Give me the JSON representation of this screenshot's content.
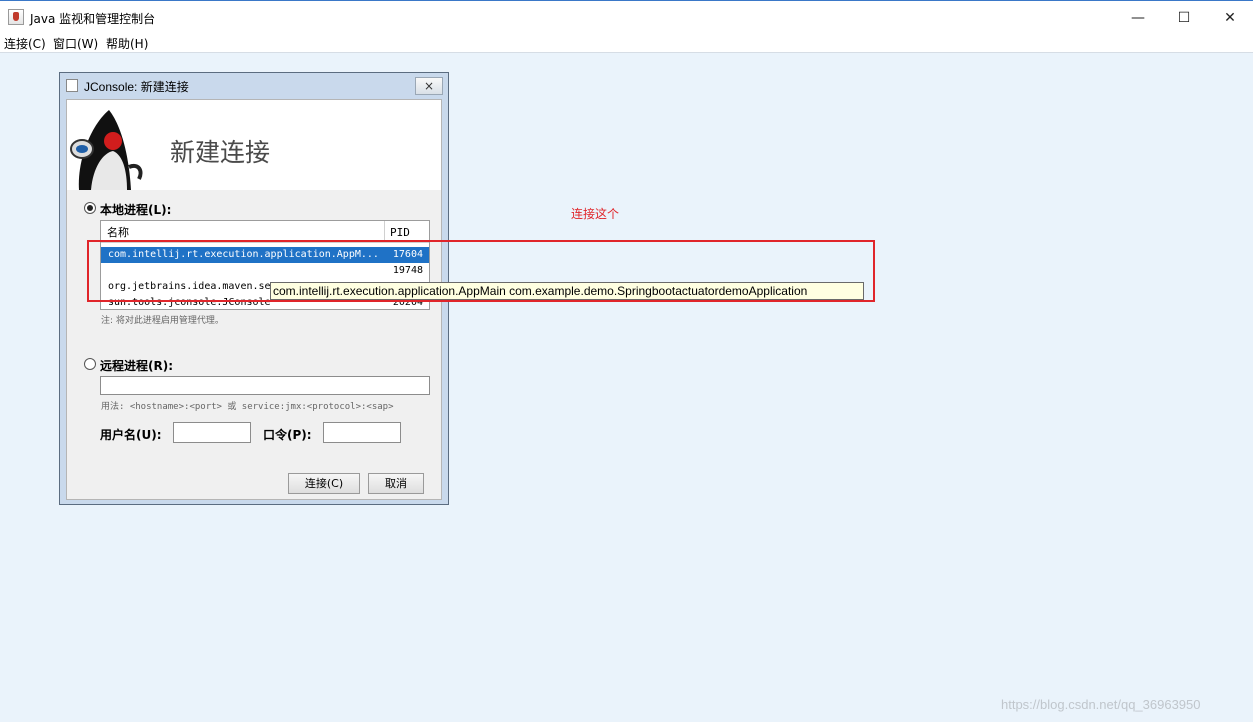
{
  "window": {
    "title": "Java 监视和管理控制台",
    "minimize": "—",
    "maximize": "☐",
    "close": "✕",
    "icon": "java-cup-icon"
  },
  "menu": [
    "连接(C)",
    "窗口(W)",
    "帮助(H)"
  ],
  "dialog": {
    "title": "JConsole: 新建连接",
    "close": "×",
    "banner_title": "新建连接",
    "local": {
      "label": "本地进程(L):",
      "selected": true,
      "columns": {
        "name": "名称",
        "pid": "PID"
      },
      "rows": [
        {
          "name": "com.intellij.rt.execution.application.AppM...",
          "pid": "17604",
          "selected": true
        },
        {
          "name": "",
          "pid": "19748"
        },
        {
          "name": "org.jetbrains.idea.maven.se",
          "pid": ""
        },
        {
          "name": "sun.tools.jconsole.JConsole",
          "pid": "20204"
        }
      ],
      "note": "注: 将对此进程启用管理代理。"
    },
    "remote": {
      "label": "远程进程(R):",
      "selected": false,
      "value": "",
      "usage": "用法: <hostname>:<port> 或 service:jmx:<protocol>:<sap>"
    },
    "username_label": "用户名(U):",
    "username_value": "",
    "password_label": "口令(P):",
    "password_value": "",
    "connect_button": "连接(C)",
    "cancel_button": "取消"
  },
  "tooltip": "com.intellij.rt.execution.application.AppMain com.example.demo.SpringbootactuatordemoApplication",
  "annotation": {
    "text": "连接这个",
    "color": "#e0252a"
  },
  "watermark": "https://blog.csdn.net/qq_36963950"
}
